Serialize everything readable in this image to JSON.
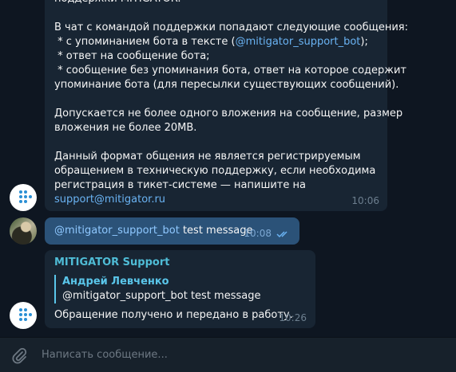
{
  "messages": [
    {
      "lines": [
        "поддержки MITIGATOR.",
        "",
        "В чат с командой поддержки попадают следующие сообщения:"
      ],
      "mention_line_prefix": " * с упоминанием бота в тексте (",
      "mention_link": "@mitigator_support_bot",
      "mention_line_suffix": ");",
      "lines2": [
        " * ответ на сообщение бота;",
        " * сообщение без упоминания бота, ответ на которое содержит",
        "упоминание бота (для пересылки существующих сообщений).",
        "",
        "Допускается не более одного вложения на сообщение, размер",
        "вложения не более 20MB.",
        "",
        "Данный формат общения не является регистрируемым",
        "обращением в техническую поддержку, если необходима",
        "регистрация в тикет-системе — напишите на"
      ],
      "email": "support@mitigator.ru",
      "time": "10:06"
    },
    {
      "mention": "@mitigator_support_bot",
      "text": " test message",
      "time": "10:08",
      "status_icon": "double-check-icon"
    },
    {
      "sender": "MITIGATOR Support",
      "reply": {
        "name": "Андрей Левченко",
        "mention": "@mitigator_support_bot",
        "text": " test message"
      },
      "text": "Обращение получено и передано в работу.",
      "time": "10:26"
    }
  ],
  "composer": {
    "placeholder": "Написать сообщение...",
    "attach_icon": "paperclip-icon"
  },
  "colors": {
    "background": "#0e1621",
    "incoming": "#182533",
    "outgoing": "#2b5278",
    "link": "#6ab3f3",
    "sender": "#4fbcd6"
  }
}
